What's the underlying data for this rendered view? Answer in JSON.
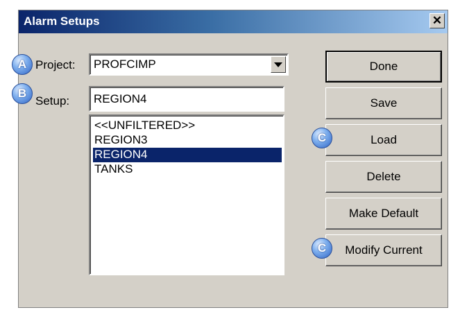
{
  "window": {
    "title": "Alarm Setups",
    "close_glyph": "✕"
  },
  "form": {
    "project_label": "Project:",
    "project_value": "PROFCIMP",
    "setup_label": "Setup:",
    "setup_value": "REGION4"
  },
  "setups_list": [
    "<<UNFILTERED>>",
    "REGION3",
    "REGION4",
    "TANKS"
  ],
  "selected_setup": "REGION4",
  "buttons": {
    "done": "Done",
    "save": "Save",
    "load": "Load",
    "delete": "Delete",
    "make_default": "Make Default",
    "modify_current": "Modify Current"
  },
  "markers": {
    "a": "A",
    "b": "B",
    "c1": "C",
    "c2": "C"
  },
  "colors": {
    "title_start": "#0a246a",
    "title_end": "#a6caf0",
    "selection": "#0a246a",
    "face": "#d4d0c8",
    "marker": "#2f63c4"
  }
}
